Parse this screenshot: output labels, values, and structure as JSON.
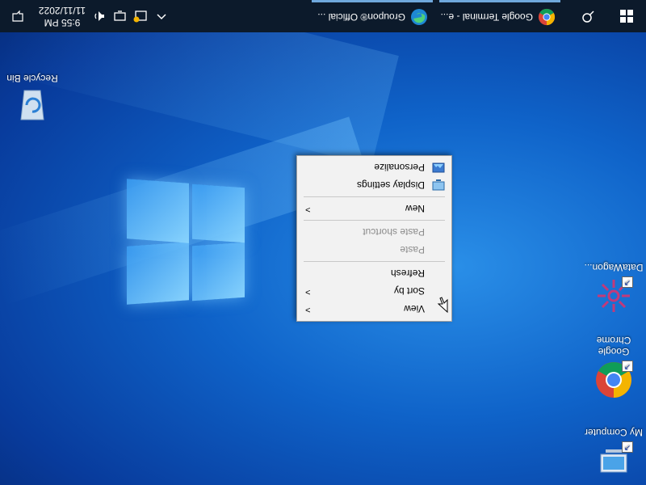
{
  "desktop": {
    "icons": [
      {
        "name": "my-computer",
        "label": "My Computer"
      },
      {
        "name": "google-chrome",
        "label": "Google Chrome"
      },
      {
        "name": "datawagon",
        "label": "DataWagon..."
      },
      {
        "name": "recycle-bin",
        "label": "Recycle Bin"
      }
    ]
  },
  "context_menu": {
    "items": [
      {
        "label": "View",
        "submenu": true
      },
      {
        "label": "Sort by",
        "submenu": true
      },
      {
        "label": "Refresh"
      },
      {
        "label": "Paste",
        "disabled": true
      },
      {
        "label": "Paste shortcut",
        "disabled": true
      },
      {
        "label": "New",
        "submenu": true
      },
      {
        "label": "Display settings"
      },
      {
        "label": "Personalize"
      }
    ]
  },
  "taskbar": {
    "apps": [
      {
        "label": "Google Terminal - e..."
      },
      {
        "label": "Groupon® Official ..."
      }
    ],
    "clock": {
      "time": "9:55 PM",
      "date": "11/11/2022"
    }
  },
  "colors": {
    "accent": "#6fa8dc",
    "taskbar": "#0c1a2b",
    "wallpaper": "#0f63c9"
  }
}
